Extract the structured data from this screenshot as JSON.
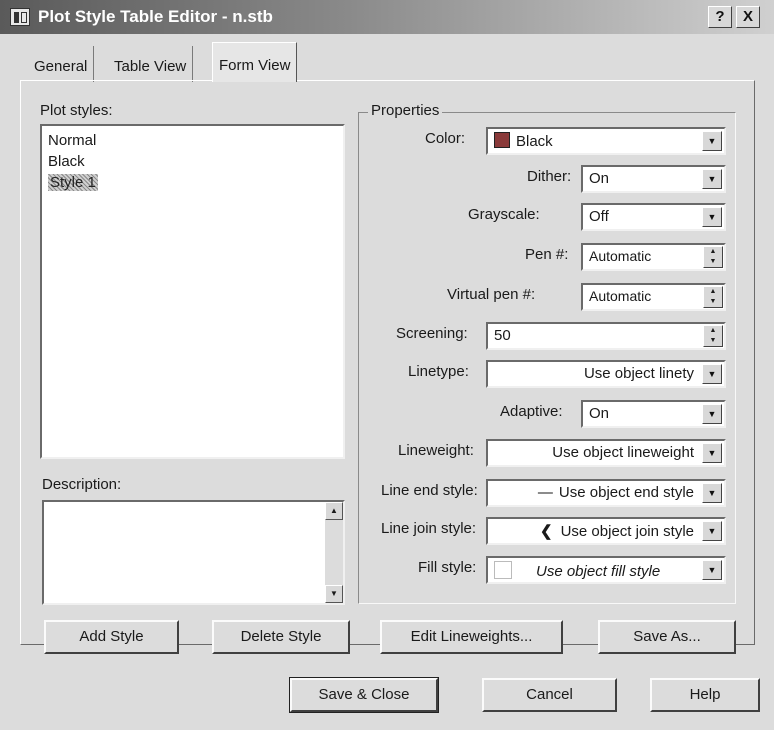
{
  "window": {
    "title": "Plot Style Table Editor - n.stb",
    "help_button": "?",
    "close_button": "X"
  },
  "tabs": [
    {
      "label": "General",
      "active": false
    },
    {
      "label": "Table View",
      "active": false
    },
    {
      "label": "Form View",
      "active": true
    }
  ],
  "plot_styles": {
    "label": "Plot styles:",
    "items": [
      {
        "label": "Normal",
        "selected": false
      },
      {
        "label": "Black",
        "selected": false
      },
      {
        "label": "Style 1",
        "selected": true
      }
    ]
  },
  "description": {
    "label": "Description:",
    "value": ""
  },
  "properties": {
    "group_label": "Properties",
    "color": {
      "label": "Color:",
      "value": "Black",
      "swatch": "#8a3a3a"
    },
    "dither": {
      "label": "Dither:",
      "value": "On"
    },
    "grayscale": {
      "label": "Grayscale:",
      "value": "Off"
    },
    "pen": {
      "label": "Pen #:",
      "value": "Automatic"
    },
    "virtual_pen": {
      "label": "Virtual pen #:",
      "value": "Automatic"
    },
    "screening": {
      "label": "Screening:",
      "value": "50"
    },
    "linetype": {
      "label": "Linetype:",
      "value": "Use object linety"
    },
    "adaptive": {
      "label": "Adaptive:",
      "value": "On"
    },
    "lineweight": {
      "label": "Lineweight:",
      "value": "Use object lineweight"
    },
    "line_end_style": {
      "label": "Line end style:",
      "value": "Use object end style",
      "icon": "line-end-icon"
    },
    "line_join_style": {
      "label": "Line join style:",
      "value": "Use object join style",
      "icon": "line-join-icon"
    },
    "fill_style": {
      "label": "Fill style:",
      "value": "Use object fill style",
      "icon": "fill-pattern-icon"
    }
  },
  "buttons": {
    "add_style": "Add Style",
    "delete_style": "Delete Style",
    "edit_lineweights": "Edit Lineweights...",
    "save_as": "Save As...",
    "save_close": "Save & Close",
    "cancel": "Cancel",
    "help": "Help"
  }
}
